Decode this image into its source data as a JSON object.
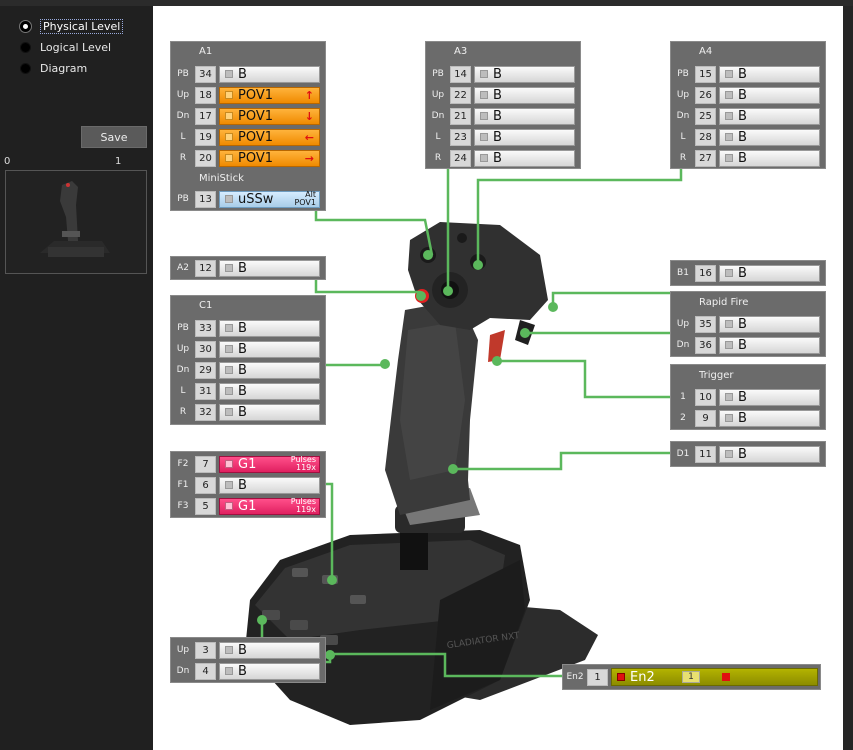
{
  "sidebar": {
    "view_options": [
      "Physical Level",
      "Logical Level",
      "Diagram"
    ],
    "selected": "Physical Level",
    "save_label": "Save",
    "index_left": "0",
    "index_right": "1"
  },
  "colors": {
    "pov_orange": "#f39200",
    "pulse_pink": "#e8336f",
    "ministick_blue": "#bfe0f5",
    "enable_olive": "#9e9e00",
    "wire_green": "#5bb85c"
  },
  "panels": {
    "a1": {
      "title": "A1",
      "rows": [
        {
          "label": "PB",
          "num": "34",
          "text": "B"
        },
        {
          "label": "Up",
          "num": "18",
          "text": "POV1",
          "arrow": "↑"
        },
        {
          "label": "Dn",
          "num": "17",
          "text": "POV1",
          "arrow": "↓"
        },
        {
          "label": "L",
          "num": "19",
          "text": "POV1",
          "arrow": "←"
        },
        {
          "label": "R",
          "num": "20",
          "text": "POV1",
          "arrow": "→"
        }
      ],
      "ministick_title": "MiniStick",
      "ministick": {
        "label": "PB",
        "num": "13",
        "text": "uSSw",
        "sup1": "Alt",
        "sup2": "POV1"
      }
    },
    "a3": {
      "title": "A3",
      "rows": [
        {
          "label": "PB",
          "num": "14",
          "text": "B"
        },
        {
          "label": "Up",
          "num": "22",
          "text": "B"
        },
        {
          "label": "Dn",
          "num": "21",
          "text": "B"
        },
        {
          "label": "L",
          "num": "23",
          "text": "B"
        },
        {
          "label": "R",
          "num": "24",
          "text": "B"
        }
      ]
    },
    "a4": {
      "title": "A4",
      "rows": [
        {
          "label": "PB",
          "num": "15",
          "text": "B"
        },
        {
          "label": "Up",
          "num": "26",
          "text": "B"
        },
        {
          "label": "Dn",
          "num": "25",
          "text": "B"
        },
        {
          "label": "L",
          "num": "28",
          "text": "B"
        },
        {
          "label": "R",
          "num": "27",
          "text": "B"
        }
      ]
    },
    "a2": {
      "label": "A2",
      "num": "12",
      "text": "B"
    },
    "c1": {
      "title": "C1",
      "rows": [
        {
          "label": "PB",
          "num": "33",
          "text": "B"
        },
        {
          "label": "Up",
          "num": "30",
          "text": "B"
        },
        {
          "label": "Dn",
          "num": "29",
          "text": "B"
        },
        {
          "label": "L",
          "num": "31",
          "text": "B"
        },
        {
          "label": "R",
          "num": "32",
          "text": "B"
        }
      ]
    },
    "b1": {
      "label": "B1",
      "num": "16",
      "text": "B"
    },
    "rapid_fire": {
      "title": "Rapid Fire",
      "rows": [
        {
          "label": "Up",
          "num": "35",
          "text": "B"
        },
        {
          "label": "Dn",
          "num": "36",
          "text": "B"
        }
      ]
    },
    "trigger": {
      "title": "Trigger",
      "rows": [
        {
          "label": "1",
          "num": "10",
          "text": "B"
        },
        {
          "label": "2",
          "num": "9",
          "text": "B"
        }
      ]
    },
    "d1": {
      "label": "D1",
      "num": "11",
      "text": "B"
    },
    "f": {
      "rows": [
        {
          "label": "F2",
          "num": "7",
          "text": "G1",
          "sup1": "Pulses",
          "sup2": "119x"
        },
        {
          "label": "F1",
          "num": "6",
          "text": "B"
        },
        {
          "label": "F3",
          "num": "5",
          "text": "G1",
          "sup1": "Pulses",
          "sup2": "119x"
        }
      ]
    },
    "updn": {
      "rows": [
        {
          "label": "Up",
          "num": "3",
          "text": "B"
        },
        {
          "label": "Dn",
          "num": "4",
          "text": "B"
        }
      ]
    },
    "en2": {
      "label": "En2",
      "num": "1",
      "text": "En2",
      "badge": "1"
    }
  },
  "device": {
    "engraving": "GLADIATOR NXT"
  }
}
